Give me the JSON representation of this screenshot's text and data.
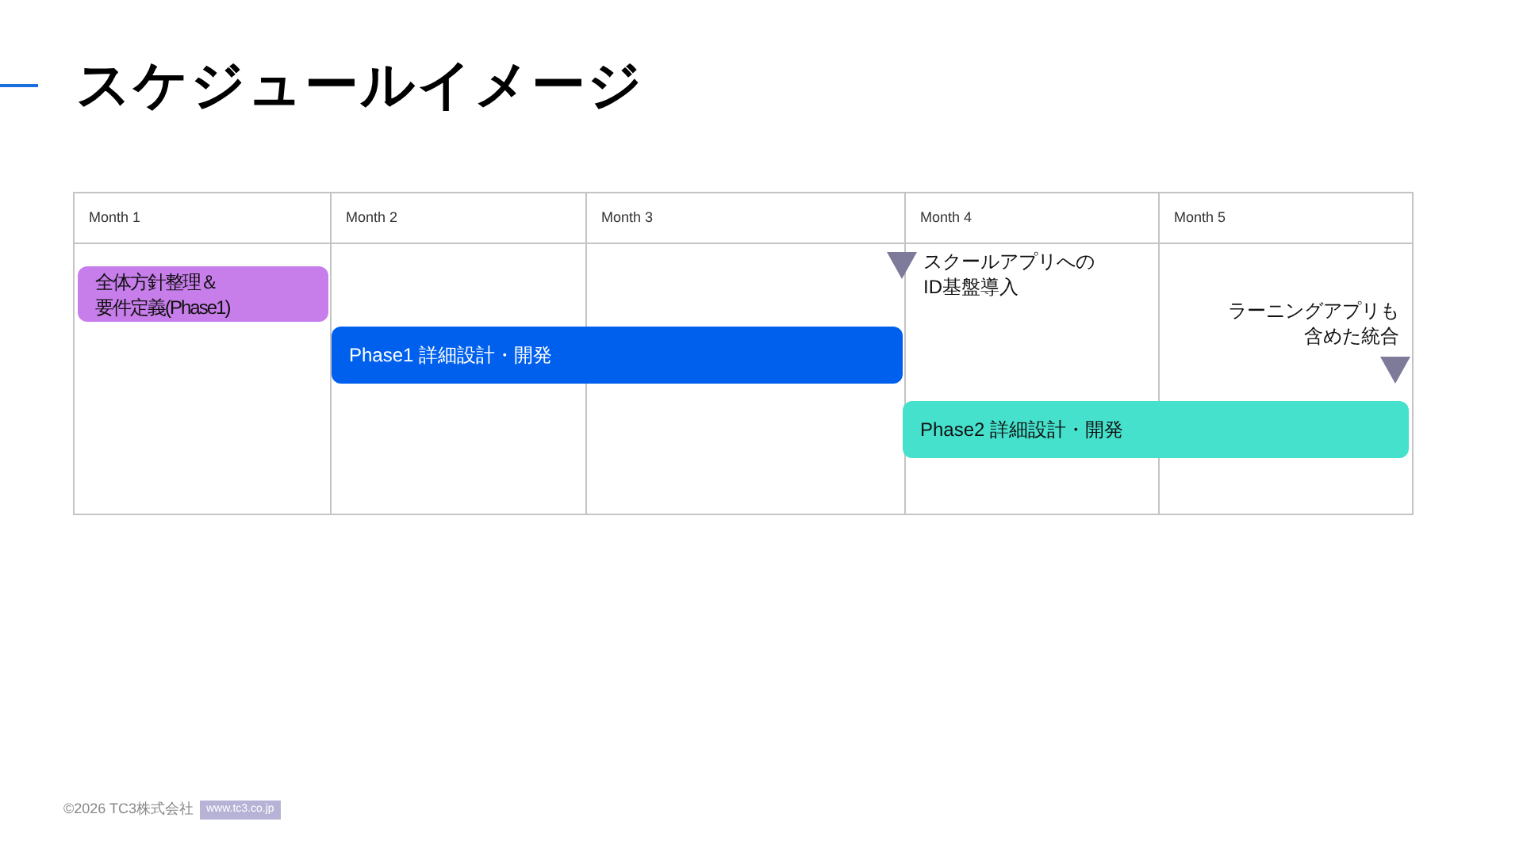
{
  "title": "スケジュールイメージ",
  "columns": [
    "Month 1",
    "Month 2",
    "Month 3",
    "Month 4",
    "Month 5"
  ],
  "tasks": [
    {
      "label": "全体方針整理＆要件定義(Phase1)",
      "color": "#c77dea"
    },
    {
      "label": "Phase1 詳細設計・開発",
      "color": "#0060ee"
    },
    {
      "label": "Phase2 詳細設計・開発",
      "color": "#45e1cc"
    }
  ],
  "milestones": [
    {
      "label": "スクールアプリへのID基盤導入",
      "kind": "left"
    },
    {
      "label": "ラーニングアプリも含めた統合",
      "kind": "right"
    }
  ],
  "footer": {
    "copyright": "©2026 TC3株式会社",
    "url": "www.tc3.co.jp"
  }
}
